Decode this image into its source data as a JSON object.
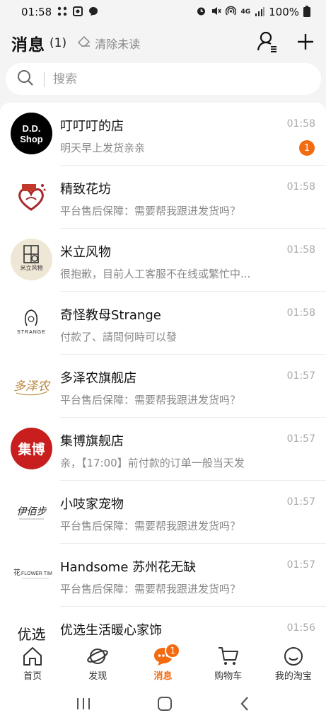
{
  "status_bar": {
    "time": "01:58",
    "battery": "100%",
    "left_icons": [
      "grid-dots-icon",
      "square-app-icon",
      "chat-bubble-icon"
    ],
    "right_icons": [
      "alarm-icon",
      "mute-icon",
      "hotspot-icon",
      "4g-lte-icon",
      "signal-icon",
      "battery-icon"
    ]
  },
  "header": {
    "title": "消息",
    "count": "(1)",
    "clear_label": "清除未读"
  },
  "search": {
    "placeholder": "搜索"
  },
  "messages": [
    {
      "name": "叮叮叮的店",
      "preview": "明天早上发货亲亲",
      "time": "01:58",
      "badge": "1",
      "avatar_text": "D.D.\nShop"
    },
    {
      "name": "精致花坊",
      "preview": "平台售后保障：需要帮我跟进发货吗？",
      "time": "01:58"
    },
    {
      "name": "米立风物",
      "preview": "很抱歉，目前人工客服不在线或繁忙中...",
      "time": "01:58",
      "avatar_text": "米立风物"
    },
    {
      "name": "奇怪教母Strange",
      "preview": "付款了、請問何時可以發",
      "time": "01:58",
      "avatar_text": "STRANGE"
    },
    {
      "name": "多泽农旗舰店",
      "preview": "平台售后保障：需要帮我跟进发货吗？",
      "time": "01:57",
      "avatar_text": "多泽农"
    },
    {
      "name": "集博旗舰店",
      "preview": "亲，【17:00】前付款的订单一般当天发",
      "time": "01:57",
      "avatar_text": "集博"
    },
    {
      "name": "小吱家宠物",
      "preview": "平台售后保障：需要帮我跟进发货吗？",
      "time": "01:57",
      "avatar_text": "伊佰步"
    },
    {
      "name": "Handsome 苏州花无缺",
      "preview": "平台售后保障：需要帮我跟进发货吗？",
      "time": "01:57",
      "avatar_text": "花FLOWER TIME"
    },
    {
      "name": "优选生活暖心家饰",
      "preview": "",
      "time": "01:56",
      "avatar_text": "优选"
    }
  ],
  "bottom_nav": [
    {
      "label": "首页",
      "icon": "home-icon"
    },
    {
      "label": "发现",
      "icon": "planet-icon"
    },
    {
      "label": "消息",
      "icon": "chat-bubble-icon",
      "badge": "1",
      "active": true
    },
    {
      "label": "购物车",
      "icon": "cart-icon"
    },
    {
      "label": "我的淘宝",
      "icon": "smiley-icon"
    }
  ],
  "colors": {
    "accent": "#f36b10",
    "muted_text": "#888888",
    "time_text": "#aaaaaa"
  }
}
